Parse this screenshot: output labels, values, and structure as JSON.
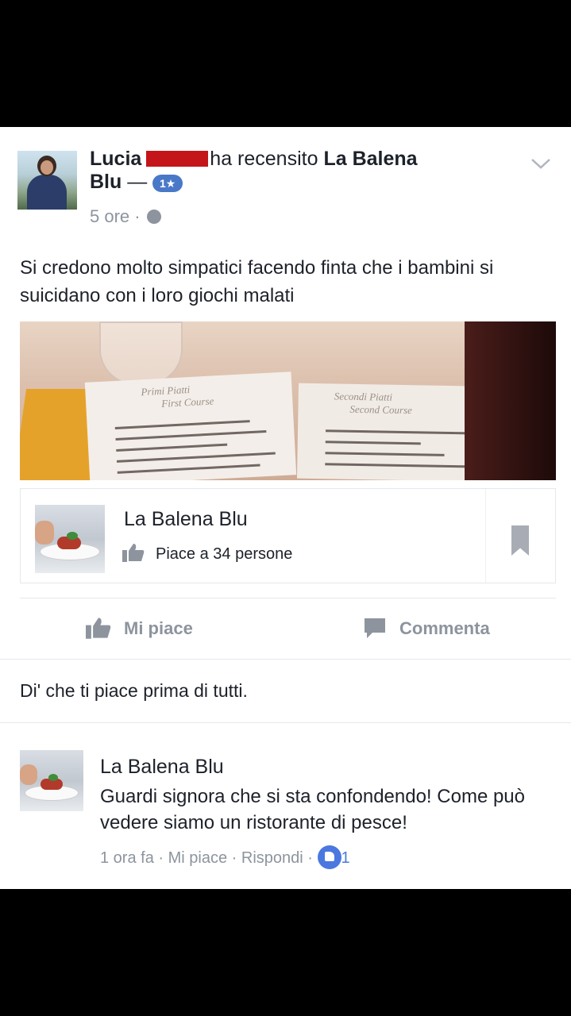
{
  "post": {
    "author_first": "Lucia",
    "action": "ha recensito",
    "page_name_part1": "La Balena",
    "page_name_part2": "Blu",
    "dash": "—",
    "rating": "1★",
    "time": "5 ore",
    "separator": "·",
    "text": "Si credono molto simpatici facendo finta che i bambini si suicidano con i loro giochi malati"
  },
  "photo": {
    "menu_left_title1": "Primi Piatti",
    "menu_left_title2": "First Course",
    "menu_right_title1": "Secondi Piatti",
    "menu_right_title2": "Second Course"
  },
  "page_card": {
    "name": "La Balena Blu",
    "likes": "Piace a 34 persone"
  },
  "actions": {
    "like": "Mi piace",
    "comment": "Commenta"
  },
  "first_like_prompt": "Di' che ti piace prima di tutti.",
  "comment": {
    "author": "La Balena Blu",
    "text": "Guardi signora che si sta confondendo! Come può vedere siamo un ristorante di pesce!",
    "time": "1 ora fa",
    "like": "Mi piace",
    "reply": "Rispondi",
    "sep": "·",
    "like_count": "1"
  },
  "colors": {
    "link_blue": "#4a78c8",
    "meta_gray": "#8d949e",
    "redaction": "#c4151a"
  },
  "icons": [
    "chevron-down-icon",
    "globe-icon",
    "thumbs-up-icon",
    "comment-bubble-icon",
    "bookmark-icon",
    "like-badge-icon"
  ]
}
